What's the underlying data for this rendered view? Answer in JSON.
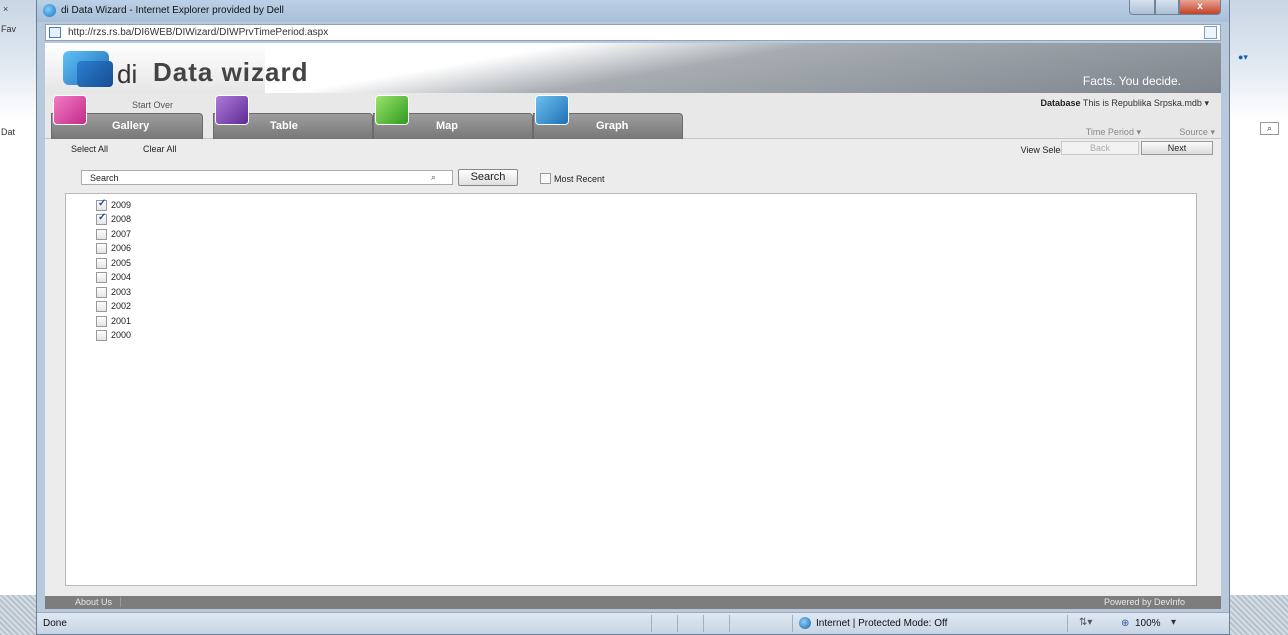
{
  "background_browser": {
    "tab_fragment": "Fav",
    "data_fragment": "Dat"
  },
  "window": {
    "title": "di Data Wizard - Internet Explorer provided by Dell",
    "close_glyph": "x",
    "url": "http://rzs.rs.ba/DI6WEB/DIWizard/DIWPrvTimePeriod.aspx"
  },
  "header": {
    "logo_prefix": "di",
    "logo_text": "Data wizard",
    "tagline": "Facts. You decide."
  },
  "nav": {
    "start_over": "Start Over",
    "tabs": [
      {
        "label": "Gallery",
        "icon": "gallery-icon"
      },
      {
        "label": "Table",
        "icon": "table-icon"
      },
      {
        "label": "Map",
        "icon": "map-icon"
      },
      {
        "label": "Graph",
        "icon": "graph-icon"
      }
    ],
    "database_label": "Database",
    "database_value": "This is Republika Srpska.mdb",
    "time_period": "Time Period",
    "source": "Source"
  },
  "actions": {
    "select_all": "Select All",
    "clear_all": "Clear All",
    "view_selections": "View Selections",
    "back": "Back",
    "next": "Next"
  },
  "search": {
    "value": "Search",
    "button": "Search",
    "most_recent": "Most Recent"
  },
  "years": [
    {
      "label": "2009",
      "checked": true
    },
    {
      "label": "2008",
      "checked": true
    },
    {
      "label": "2007",
      "checked": false
    },
    {
      "label": "2006",
      "checked": false
    },
    {
      "label": "2005",
      "checked": false
    },
    {
      "label": "2004",
      "checked": false
    },
    {
      "label": "2003",
      "checked": false
    },
    {
      "label": "2002",
      "checked": false
    },
    {
      "label": "2001",
      "checked": false
    },
    {
      "label": "2000",
      "checked": false
    }
  ],
  "footer": {
    "about_us": "About Us",
    "powered_by": "Powered by DevInfo"
  },
  "status": {
    "left": "Done",
    "zone": "Internet | Protected Mode: Off",
    "zoom": "100%"
  }
}
